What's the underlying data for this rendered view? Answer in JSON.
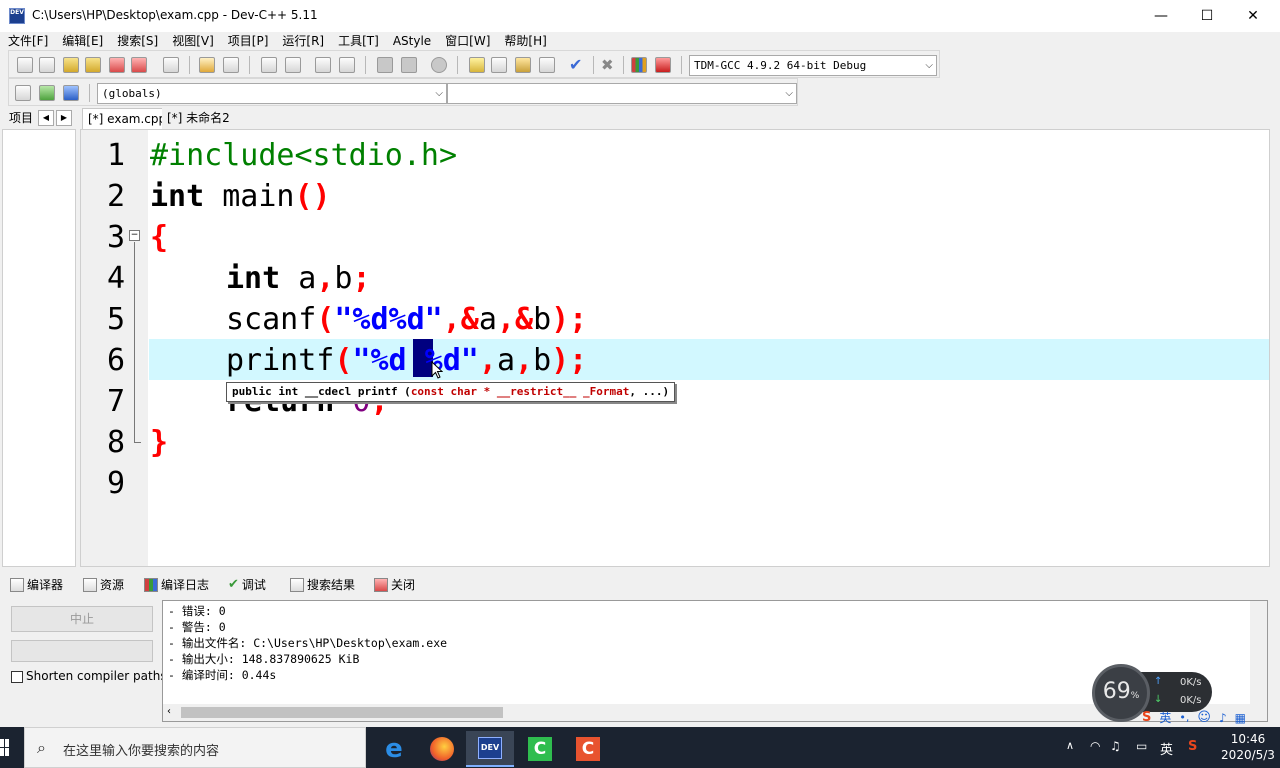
{
  "window": {
    "title": "C:\\Users\\HP\\Desktop\\exam.cpp - Dev-C++ 5.11",
    "icon_text": "DEV",
    "minimize_glyph": "—",
    "maximize_glyph": "☐",
    "close_glyph": "✕"
  },
  "menu": [
    "文件[F]",
    "编辑[E]",
    "搜索[S]",
    "视图[V]",
    "项目[P]",
    "运行[R]",
    "工具[T]",
    "AStyle",
    "窗口[W]",
    "帮助[H]"
  ],
  "toolbar": {
    "compiler_select": "TDM-GCC 4.9.2 64-bit Debug",
    "scope_select": "(globals)",
    "member_select": ""
  },
  "tabs": {
    "project_label": "项目",
    "files": [
      "[*] exam.cpp",
      "[*] 未命名2"
    ],
    "active_index": 0
  },
  "editor": {
    "line_numbers": [
      "1",
      "2",
      "3",
      "4",
      "5",
      "6",
      "7",
      "8",
      "9"
    ],
    "fold_glyph": "−",
    "tooltip": {
      "prefix": "public int __cdecl printf (",
      "params": "const char * __restrict__ _Format",
      "suffix": ", ...)"
    },
    "code": {
      "l1": "#include<stdio.h>",
      "l2_kw": "int",
      "l2_rest": " main",
      "l2_sym": "()",
      "l3": "{",
      "l4_kw": "int",
      "l4_rest": " a",
      "l4_sym1": ",",
      "l4_rest2": "b",
      "l4_sym2": ";",
      "l5_fn": "scanf",
      "l5_p1": "(",
      "l5_str": "\"%d%d\"",
      "l5_c1": ",&",
      "l5_a": "a",
      "l5_c2": ",&",
      "l5_b": "b",
      "l5_end": ");",
      "l6_fn": "printf",
      "l6_p1": "(",
      "l6_str": "\"%d %d\"",
      "l6_c1": ",",
      "l6_a": "a",
      "l6_c2": ",",
      "l6_b": "b",
      "l6_end": ");",
      "l7_kw": "return",
      "l7_num": " 0",
      "l7_end": ";",
      "l8": "}"
    }
  },
  "bottom": {
    "tabs": [
      "编译器",
      "资源",
      "编译日志",
      "调试",
      "搜索结果",
      "关闭"
    ],
    "stop_button": "中止",
    "shorten_label": "Shorten compiler paths",
    "log": [
      "- 错误: 0",
      "- 警告: 0",
      "- 输出文件名: C:\\Users\\HP\\Desktop\\exam.exe",
      "- 输出大小: 148.837890625 KiB",
      "- 编译时间: 0.44s"
    ]
  },
  "widget": {
    "percent": "69",
    "percent_unit": "%",
    "up_speed": "0K/s",
    "down_speed": "0K/s"
  },
  "taskbar": {
    "search_placeholder": "在这里输入你要搜索的内容",
    "ime": "英",
    "time": "10:46",
    "date": "2020/5/3"
  },
  "colors": {
    "keyword": "#000000",
    "preprocessor": "#008000",
    "symbol": "#ff0000",
    "string": "#0000ff",
    "number": "#800080",
    "current_line": "#d2f8ff",
    "selection": "#000080"
  }
}
